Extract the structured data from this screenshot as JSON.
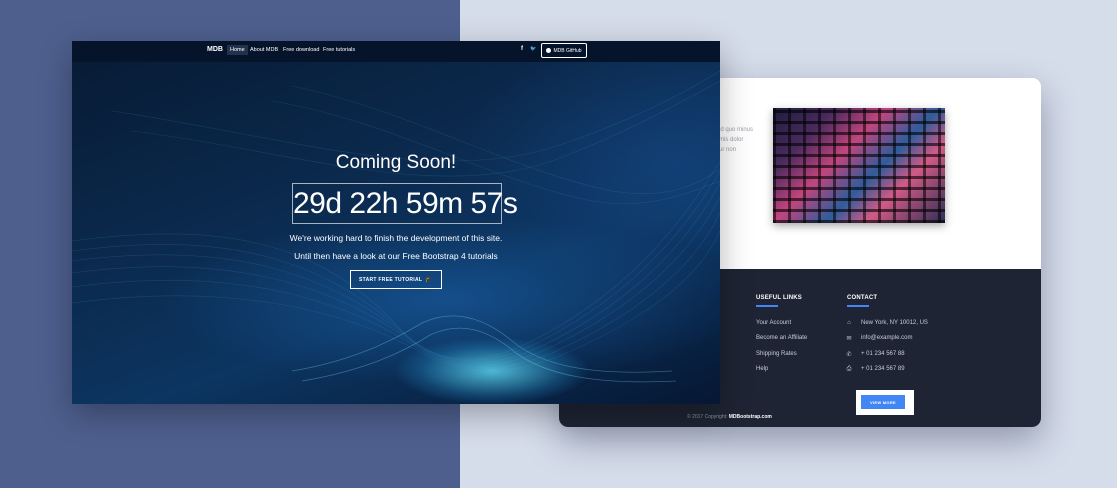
{
  "colors": {
    "left_background": "#4e5f8e",
    "right_background": "#d5dcea",
    "accent_blue": "#4285f4",
    "footer_background": "#1e2433",
    "navbar_background": "#06142b"
  },
  "front_page": {
    "navbar": {
      "brand": "MDB",
      "items": [
        {
          "label": "Home",
          "active": true
        },
        {
          "label": "About MDB",
          "active": false
        },
        {
          "label": "Free download",
          "active": false
        },
        {
          "label": "Free tutorials",
          "active": false
        }
      ],
      "social": [
        {
          "icon": "facebook-icon",
          "glyph": "f"
        },
        {
          "icon": "twitter-icon",
          "glyph": "🐦"
        }
      ],
      "github_button": {
        "icon": "github-icon",
        "label": "MDB GitHub"
      }
    },
    "hero": {
      "title": "Coming Soon!",
      "countdown": "29d 22h 59m 57s",
      "line1": "We're working hard to finish the development of this site.",
      "line2": "Until then have a look at our Free Bootstrap 4 tutorials",
      "cta": {
        "label": "START FREE TUTORIAL",
        "icon": "graduation-cap-icon"
      }
    }
  },
  "back_page": {
    "partial_text": "id quo minus\nmis dolor\nur non",
    "footer": {
      "useful_links": {
        "heading": "USEFUL LINKS",
        "items": [
          "Your Account",
          "Become an Affiliate",
          "Shipping Rates",
          "Help"
        ]
      },
      "contact": {
        "heading": "CONTACT",
        "items": [
          {
            "icon": "home-icon",
            "glyph": "⌂",
            "text": "New York, NY 10012, US"
          },
          {
            "icon": "envelope-icon",
            "glyph": "✉",
            "text": "info@example.com"
          },
          {
            "icon": "phone-icon",
            "glyph": "✆",
            "text": "+ 01 234 567 88"
          },
          {
            "icon": "print-icon",
            "glyph": "⎙",
            "text": "+ 01 234 567 89"
          }
        ]
      },
      "view_more": "VIEW MORE",
      "copyright_prefix": "© 2017 Copyright: ",
      "copyright_link": "MDBootstrap.com"
    }
  }
}
